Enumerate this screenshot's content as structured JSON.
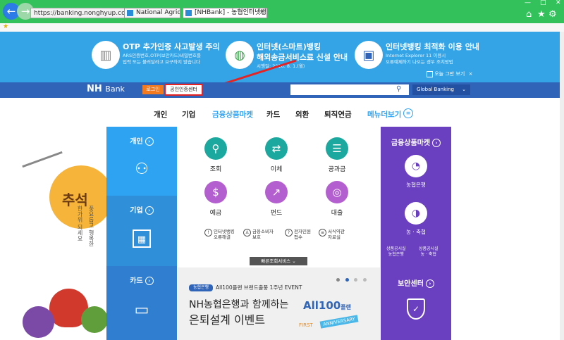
{
  "browser": {
    "address": "https://banking.nonghyup.com/nhba",
    "tabs": [
      {
        "title": "National Agric..."
      },
      {
        "title": "[NHBank] - 농협인터넷뱅킹"
      }
    ],
    "window_controls": [
      "—",
      "□",
      "✕"
    ]
  },
  "top_banners": [
    {
      "title": "OTP 추가인증 사고발생 주의",
      "desc": [
        "ARS인증번호,OTP(보안카드)비밀번호를",
        "입력 또는 불러달라고 요구하지 않습니다"
      ],
      "icon": "otp-card-icon"
    },
    {
      "title": "인터넷(스마트)뱅킹",
      "title2": "해외송금서비스료 신설 안내",
      "desc": [
        "시행일: 2016. 8. 1.(월)"
      ],
      "icon": "globe-icon"
    },
    {
      "title": "인터넷뱅킹 최적화 이용 안내",
      "desc": [
        "Internet Explorer 11 이용시",
        "오류예제하기 나오는 경우 조치방법"
      ],
      "icon": "monitor-icon"
    }
  ],
  "today_close": "오늘 그만 보기",
  "header": {
    "logo_nh": "NH",
    "logo_bank": "Bank",
    "login": "로그인",
    "cert_center": "공인인증센터",
    "search_placeholder": "",
    "global_banking": "Global Banking"
  },
  "gnb": [
    "개인",
    "기업",
    "금융상품마켓",
    "카드",
    "외환",
    "퇴직연금",
    "메뉴더보기"
  ],
  "left_column": [
    {
      "label": "개인",
      "icon": "person-won-icon"
    },
    {
      "label": "기업",
      "icon": "building-icon"
    },
    {
      "label": "카드",
      "icon": "card-icon"
    }
  ],
  "services": [
    {
      "name": "조회",
      "icon": "search-icon",
      "color": "#1ba89e"
    },
    {
      "name": "이체",
      "icon": "transfer-icon",
      "color": "#1ba89e"
    },
    {
      "name": "공과금",
      "icon": "bill-icon",
      "color": "#1ba89e"
    },
    {
      "name": "예금",
      "icon": "money-bag-icon",
      "color": "#b45fcf"
    },
    {
      "name": "펀드",
      "icon": "chart-up-icon",
      "color": "#b45fcf"
    },
    {
      "name": "대출",
      "icon": "coins-icon",
      "color": "#b45fcf"
    }
  ],
  "small_services": [
    {
      "line1": "인터넷뱅킹",
      "line2": "오류해결"
    },
    {
      "line1": "금융소비자",
      "line2": "보호"
    },
    {
      "line1": "전자민원",
      "line2": "접수"
    },
    {
      "line1": "서식약관",
      "line2": "자료실"
    }
  ],
  "more_services": "빠른조회서비스",
  "promo": {
    "tag": "농협은행",
    "subtitle": "All100플랜 브랜드출풍 1주년 EVENT",
    "line1": "NH농협은행과 함께하는",
    "line2": "은퇴설계 이벤트",
    "logo_text": "All100",
    "logo_sub": "플랜",
    "ribbon": "ANNIVERSARY",
    "first": "FIRST"
  },
  "right_column": {
    "title": "금융상품마켓",
    "items": [
      {
        "name": "농협은행",
        "icon": "pie-chart-icon"
      },
      {
        "name": "농 · 축협",
        "icon": "globe-chart-icon"
      }
    ],
    "small": [
      {
        "line1": "상품공시실",
        "line2": "농협은행"
      },
      {
        "line1": "상품공시실",
        "line2": "농 · 축협"
      }
    ],
    "security": "보안센터"
  },
  "deco_text": [
    "추석",
    "풍요롭고 행복한",
    "한가위 되세요"
  ],
  "colors": {
    "chrome": "#33c15b",
    "banner": "#35a4e6",
    "header": "#2f64b8",
    "left_top": "#2ea3f2",
    "left_mid": "#2f8fd8",
    "left_bottom": "#2f7ed0",
    "right": "#6a3fc0",
    "highlight": "#e52323"
  }
}
